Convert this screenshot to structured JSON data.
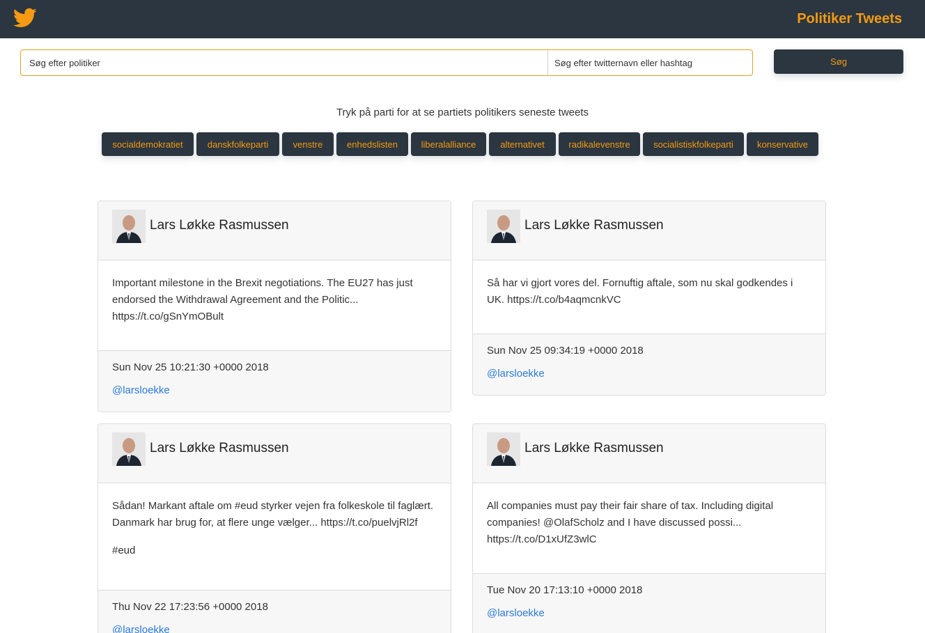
{
  "navbar": {
    "logo_icon": "twitter-bird-icon",
    "brand": "Politiker Tweets",
    "background": "#2b3640",
    "accent": "#f59a12"
  },
  "search": {
    "politician_placeholder": "Søg efter politiker",
    "handle_placeholder": "Søg efter twitternavn eller hashtag",
    "button_label": "Søg"
  },
  "instruction": "Tryk på parti for at se partiets politikers seneste tweets",
  "parties": [
    {
      "label": "socialdemokratiet"
    },
    {
      "label": "danskfolkeparti"
    },
    {
      "label": "venstre"
    },
    {
      "label": "enhedslisten"
    },
    {
      "label": "liberalalliance"
    },
    {
      "label": "alternativet"
    },
    {
      "label": "radikalevenstre"
    },
    {
      "label": "socialistiskfolkeparti"
    },
    {
      "label": "konservative"
    }
  ],
  "tweets": [
    {
      "name": "Lars Løkke Rasmussen",
      "text": "Important milestone in the Brexit negotiations. The EU27 has just endorsed the Withdrawal Agreement and the Politic... https://t.co/gSnYmOBult",
      "hashtags": "",
      "date": "Sun Nov 25 10:21:30 +0000 2018",
      "handle": "@larsloekke"
    },
    {
      "name": "Lars Løkke Rasmussen",
      "text": "Så har vi gjort vores del. Fornuftig aftale, som nu skal godkendes i UK. https://t.co/b4aqmcnkVC",
      "hashtags": "",
      "date": "Sun Nov 25 09:34:19 +0000 2018",
      "handle": "@larsloekke"
    },
    {
      "name": "Lars Løkke Rasmussen",
      "text": "Sådan! Markant aftale om #eud styrker vejen fra folkeskole til faglært. Danmark har brug for, at flere unge vælger... https://t.co/puelvjRl2f",
      "hashtags": "#eud",
      "date": "Thu Nov 22 17:23:56 +0000 2018",
      "handle": "@larsloekke"
    },
    {
      "name": "Lars Løkke Rasmussen",
      "text": "All companies must pay their fair share of tax. Including digital companies! @OlafScholz and I have discussed possi... https://t.co/D1xUfZ3wlC",
      "hashtags": "",
      "date": "Tue Nov 20 17:13:10 +0000 2018",
      "handle": "@larsloekke"
    }
  ]
}
